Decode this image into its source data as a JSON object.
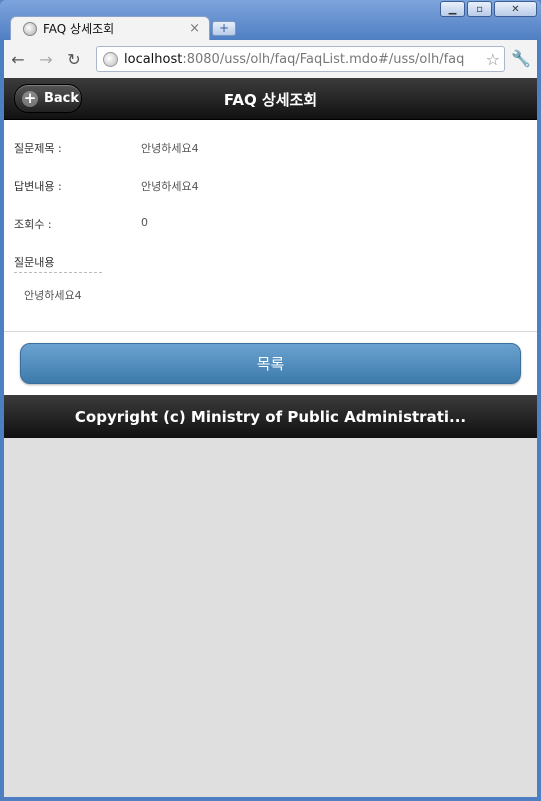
{
  "browser": {
    "tab_title": "FAQ 상세조회",
    "tab_close": "×",
    "new_tab": "+",
    "url_host": "localhost",
    "url_rest": ":8080/uss/olh/faq/FaqList.mdo#/uss/olh/faq",
    "window_controls": {
      "minimize": "▁",
      "maximize": "▫",
      "close": "✕"
    },
    "nav": {
      "back": "←",
      "forward": "→",
      "reload": "↻",
      "star": "☆",
      "wrench": "🔧"
    }
  },
  "header": {
    "back_label": "Back",
    "title": "FAQ 상세조회"
  },
  "detail": {
    "rows": [
      {
        "label": "질문제목 :",
        "value": "안녕하세요4"
      },
      {
        "label": "답변내용 :",
        "value": "안녕하세요4"
      },
      {
        "label": "조회수 :",
        "value": "0"
      }
    ],
    "question_label": "질문내용",
    "question_body": "안녕하세요4"
  },
  "list_button": "목록",
  "footer": "Copyright (c) Ministry of Public Administrati..."
}
